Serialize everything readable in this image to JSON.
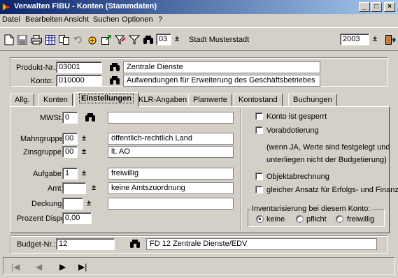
{
  "window": {
    "title": "Verwalten FIBU - Konten (Stammdaten)",
    "minimize": "_",
    "maximize": "□",
    "close": "×"
  },
  "menu": [
    "Datei",
    "Bearbeiten",
    "Ansicht",
    "Suchen",
    "Optionen",
    "?"
  ],
  "toolbar": {
    "mandant_number": "03",
    "mandant_name": "Stadt Musterstadt",
    "year": "2003",
    "spin_glyph": "±"
  },
  "header": {
    "produkt_label": "Produkt-Nr.:",
    "produkt_value": "03001",
    "produkt_desc": "Zentrale Dienste",
    "konto_label": "Konto:",
    "konto_value": "010000",
    "konto_desc": "Aufwendungen für Erweiterung des Geschäftsbetriebes"
  },
  "tabs": [
    "Allg.",
    "Konten",
    "Einstellungen",
    "KLR-Angaben",
    "Planwerte",
    "Kontostand",
    "Buchungen"
  ],
  "active_tab": "Einstellungen",
  "fields": {
    "mwst_label": "MWSt.:",
    "mwst_value": "0",
    "mwst_desc": "",
    "mahngruppe_label": "Mahngruppe:",
    "mahngruppe_value": "00",
    "mahngruppe_desc": "öffentlich-rechtlich Land",
    "zinsgruppe_label": "Zinsgruppe:",
    "zinsgruppe_value": "00",
    "zinsgruppe_desc": "lt. AO",
    "aufgabe_label": "Aufgabe:",
    "aufgabe_value": "1",
    "aufgabe_desc": "freiwillig",
    "amt_label": "Amt:",
    "amt_value": "",
    "amt_desc": "keine Amtszuordnung",
    "deckung_label": "Deckung:",
    "deckung_value": "",
    "deckung_desc": "",
    "prozent_label": "Prozent Dispo:",
    "prozent_value": "0,00"
  },
  "options": {
    "gesperrt": "Konto ist gesperrt",
    "vorab": "Vorabdotierung",
    "vorab_note_1": "(wenn JA, Werte sind festgelegt und",
    "vorab_note_2": "unterliegen nicht der Budgetierung)",
    "objekt": "Objektabrechnung",
    "gleicher": "gleicher Ansatz für Erfolgs- und Finanzk.",
    "inv_title": "Inventarisierung bei diesem Konto:",
    "inv_options": [
      "keine",
      "pflicht",
      "freiwillig"
    ],
    "inv_selected": "keine"
  },
  "budget": {
    "label": "Budget-Nr.:",
    "value": "12",
    "desc": "FD 12 Zentrale Dienste/EDV"
  },
  "navigation": {
    "first": "|◀",
    "prev": "◀",
    "next": "▶",
    "last": "▶|"
  }
}
